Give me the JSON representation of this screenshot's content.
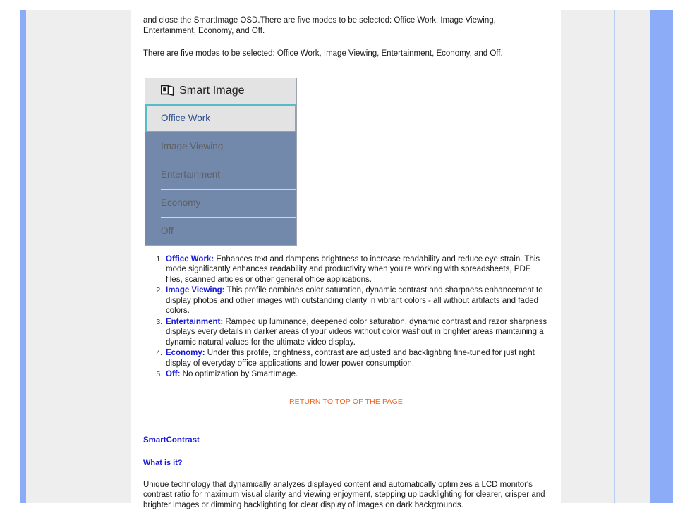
{
  "page": {
    "intro_paragraph": "and close the SmartImage OSD.There are five modes to be selected: Office Work, Image Viewing, Entertainment, Economy, and Off.",
    "modes_paragraph": "There are five modes to be selected: Office Work, Image Viewing, Entertainment, Economy, and Off."
  },
  "osd": {
    "title": "Smart Image",
    "icon": "smartimage-cube-icon",
    "items": [
      {
        "label": "Office Work",
        "selected": true
      },
      {
        "label": "Image Viewing",
        "selected": false
      },
      {
        "label": "Entertainment",
        "selected": false
      },
      {
        "label": "Economy",
        "selected": false
      },
      {
        "label": "Off",
        "selected": false
      }
    ],
    "colors": {
      "body": "#7289ab",
      "header": "#e3e3e3",
      "selected_border": "#57bcc8",
      "selected_text": "#2b4c8c",
      "item_text": "#5f5f5f"
    }
  },
  "modes_list": [
    {
      "name": "Office Work:",
      "description": " Enhances text and dampens brightness to increase readability and reduce eye strain. This mode significantly enhances readability and productivity when you're working with spreadsheets, PDF files, scanned articles or other general office applications."
    },
    {
      "name": "Image Viewing:",
      "description": " This profile combines color saturation, dynamic contrast and sharpness enhancement to display photos and other images with outstanding clarity in vibrant colors - all without artifacts and faded colors."
    },
    {
      "name": "Entertainment:",
      "description": " Ramped up luminance, deepened color saturation, dynamic contrast and razor sharpness displays every details in darker areas of your videos without color washout in brighter areas maintaining a dynamic natural values for the ultimate video display."
    },
    {
      "name": "Economy:",
      "description": " Under this profile, brightness, contrast are adjusted and backlighting fine-tuned for just right display of everyday office applications and lower power consumption."
    },
    {
      "name": "Off:",
      "description": " No optimization by SmartImage."
    }
  ],
  "return_link": {
    "label": "RETURN TO TOP OF THE PAGE",
    "color": "#f26522"
  },
  "smartcontrast": {
    "heading": "SmartContrast",
    "sub_heading": "What is it?",
    "paragraph": "Unique technology that dynamically analyzes displayed content and automatically optimizes a LCD monitor's contrast ratio for maximum visual clarity and viewing enjoyment, stepping up backlighting for clearer, crisper and brighter images or dimming backlighting for clear display of images on dark backgrounds."
  },
  "chrome": {
    "rail_color": "#8cacf7",
    "gutter_color": "#eeeeee"
  }
}
